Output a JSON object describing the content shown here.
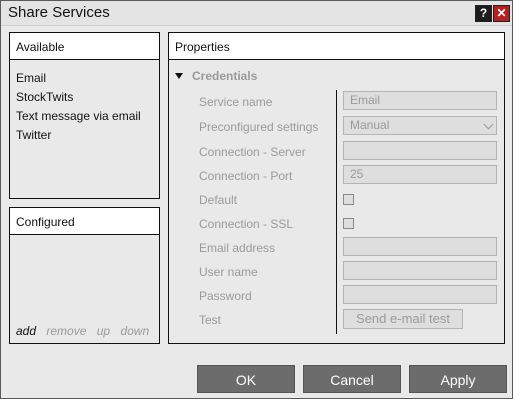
{
  "window": {
    "title": "Share Services",
    "help_label": "?",
    "close_label": "✕"
  },
  "available": {
    "title": "Available",
    "items": [
      "Email",
      "StockTwits",
      "Text message via email",
      "Twitter"
    ]
  },
  "configured": {
    "title": "Configured",
    "links": {
      "add": "add",
      "remove": "remove",
      "up": "up",
      "down": "down"
    }
  },
  "properties": {
    "title": "Properties",
    "section": "Credentials",
    "labels": {
      "service_name": "Service name",
      "preconfigured": "Preconfigured settings",
      "server": "Connection - Server",
      "port": "Connection - Port",
      "default": "Default",
      "ssl": "Connection - SSL",
      "email": "Email address",
      "user": "User name",
      "password": "Password",
      "test": "Test"
    },
    "values": {
      "service_name": "Email",
      "preconfigured": "Manual",
      "server": "",
      "port": "25",
      "default_checked": false,
      "ssl_checked": false,
      "email": "",
      "user": "",
      "password": ""
    },
    "test_button": "Send e-mail test"
  },
  "footer": {
    "ok": "OK",
    "cancel": "Cancel",
    "apply": "Apply"
  },
  "icons": {
    "collapse": "triangle-down-icon",
    "dropdown": "chevron-down-icon",
    "help": "help-icon",
    "close": "close-icon"
  }
}
